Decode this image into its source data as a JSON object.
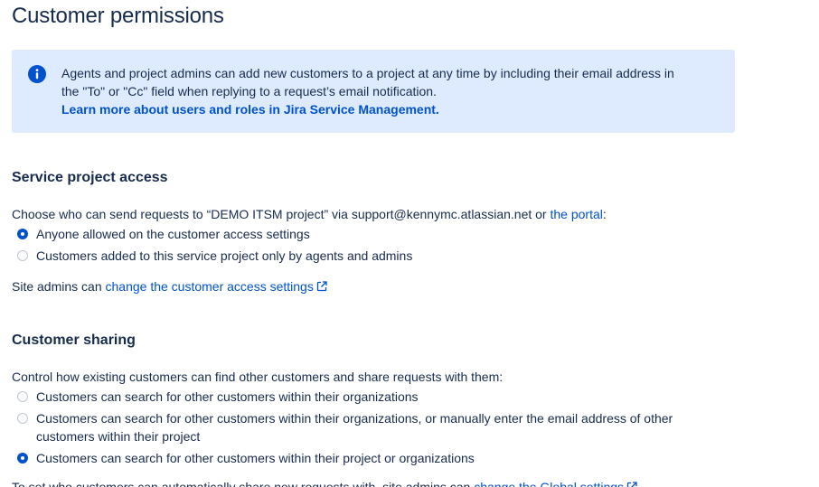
{
  "page": {
    "title": "Customer permissions"
  },
  "info_panel": {
    "icon": "info-icon",
    "text_line1": "Agents and project admins can add new customers to a project at any time by including their email address in",
    "text_line2": "the \"To\" or \"Cc\" field when replying to a request’s email notification.",
    "link_text": "Learn more about users and roles in Jira Service Management."
  },
  "service_project_access": {
    "heading": "Service project access",
    "description_prefix": "Choose who can send requests to “DEMO ITSM project” via support@kennymc.atlassian.net or ",
    "portal_link": "the portal",
    "description_suffix": ":",
    "options": [
      {
        "label": "Anyone allowed on the customer access settings",
        "selected": true
      },
      {
        "label": "Customers added to this service project only by agents and admins",
        "selected": false
      }
    ],
    "site_admins_prefix": "Site admins can ",
    "settings_link": "change the customer access settings",
    "settings_link_icon": "external-link-icon"
  },
  "customer_sharing": {
    "heading": "Customer sharing",
    "description": "Control how existing customers can find other customers and share requests with them:",
    "options": [
      {
        "label": "Customers can search for other customers within their organizations",
        "selected": false
      },
      {
        "label": "Customers can search for other customers within their organizations, or manually enter the email address of other customers within their project",
        "selected": false
      },
      {
        "label": "Customers can search for other customers within their project or organizations",
        "selected": true
      }
    ],
    "footer_prefix": "To set who customers can automatically share new requests with, site admins can ",
    "footer_link": "change the Global settings",
    "footer_link_icon": "external-link-icon"
  },
  "colors": {
    "text": "#172B4D",
    "link": "#0052CC",
    "info_background": "#DEEBFF",
    "radio_selected": "#0052CC"
  }
}
